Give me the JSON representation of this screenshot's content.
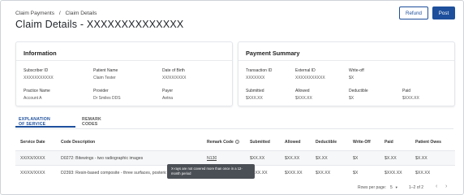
{
  "breadcrumb": {
    "items": [
      "Claim Payments",
      "/",
      "Claim Details"
    ]
  },
  "page": {
    "title": "Claim Details - XXXXXXXXXXXXXX"
  },
  "actions": {
    "refund_label": "Refund",
    "post_label": "Post"
  },
  "information": {
    "heading": "Information",
    "fields": [
      {
        "label": "Subscriber ID",
        "value": "XXXXXXXXXXX"
      },
      {
        "label": "Patient Name",
        "value": "Claim Tester"
      },
      {
        "label": "Date of Birth",
        "value": "XX/XX/XXXX"
      },
      {
        "label": "Practice Name",
        "value": "Account A"
      },
      {
        "label": "Provider",
        "value": "Dr Smiles DDS"
      },
      {
        "label": "Payer",
        "value": "Aetna"
      }
    ]
  },
  "payment_summary": {
    "heading": "Payment Summary",
    "fields": [
      {
        "label": "Transaction ID",
        "value": "XXXXXXX"
      },
      {
        "label": "External ID",
        "value": "XXXXXXXXXXX"
      },
      {
        "label": "Write-off",
        "value": "$X"
      },
      {
        "label": "Submitted",
        "value": "$XXX.XX"
      },
      {
        "label": "Allowed",
        "value": "$XXX.XX"
      },
      {
        "label": "Deductible",
        "value": "$X"
      },
      {
        "label": "Paid",
        "value": "$XXX.XX"
      }
    ]
  },
  "tabs": [
    {
      "label": "EXPLANATION OF SERVICE",
      "active": true
    },
    {
      "label": "REMARK CODES",
      "active": false
    }
  ],
  "table": {
    "columns": [
      "Service Date",
      "Code Description",
      "Remark Code",
      "Submitted",
      "Allowed",
      "Deductible",
      "Write-Off",
      "Paid",
      "Patient Owes"
    ],
    "rows": [
      [
        "XX/XX/XXXX",
        "D0272: Bitewings - two radiographic images",
        "N130",
        "$XX.XX",
        "$XX.XX",
        "$X.XX",
        "$X",
        "$X.XX",
        "$X.XX"
      ],
      [
        "XX/XX/XXXX",
        "D2393: Resin-based composite - three surfaces, posterior",
        "",
        "$XXX.XX",
        "$XXX.XX",
        "$XX.XX",
        "$X",
        "$XXX.XX",
        "$XX.XX"
      ]
    ]
  },
  "tooltip": {
    "text": "X-rays are not covered more than once in a 12-month period"
  },
  "pagination": {
    "rows_per_page_label": "Rows per page:",
    "rows_per_page_value": "5",
    "range": "1–2 of 2"
  },
  "icons": {
    "info": "info-icon",
    "prev": "chevron-left-icon",
    "next": "chevron-right-icon",
    "dropdown": "caret-down-icon"
  },
  "colors": {
    "primary": "#1d4f9c",
    "tooltip_bg": "#4a4f55",
    "row_highlight": "#f6f7f8"
  }
}
